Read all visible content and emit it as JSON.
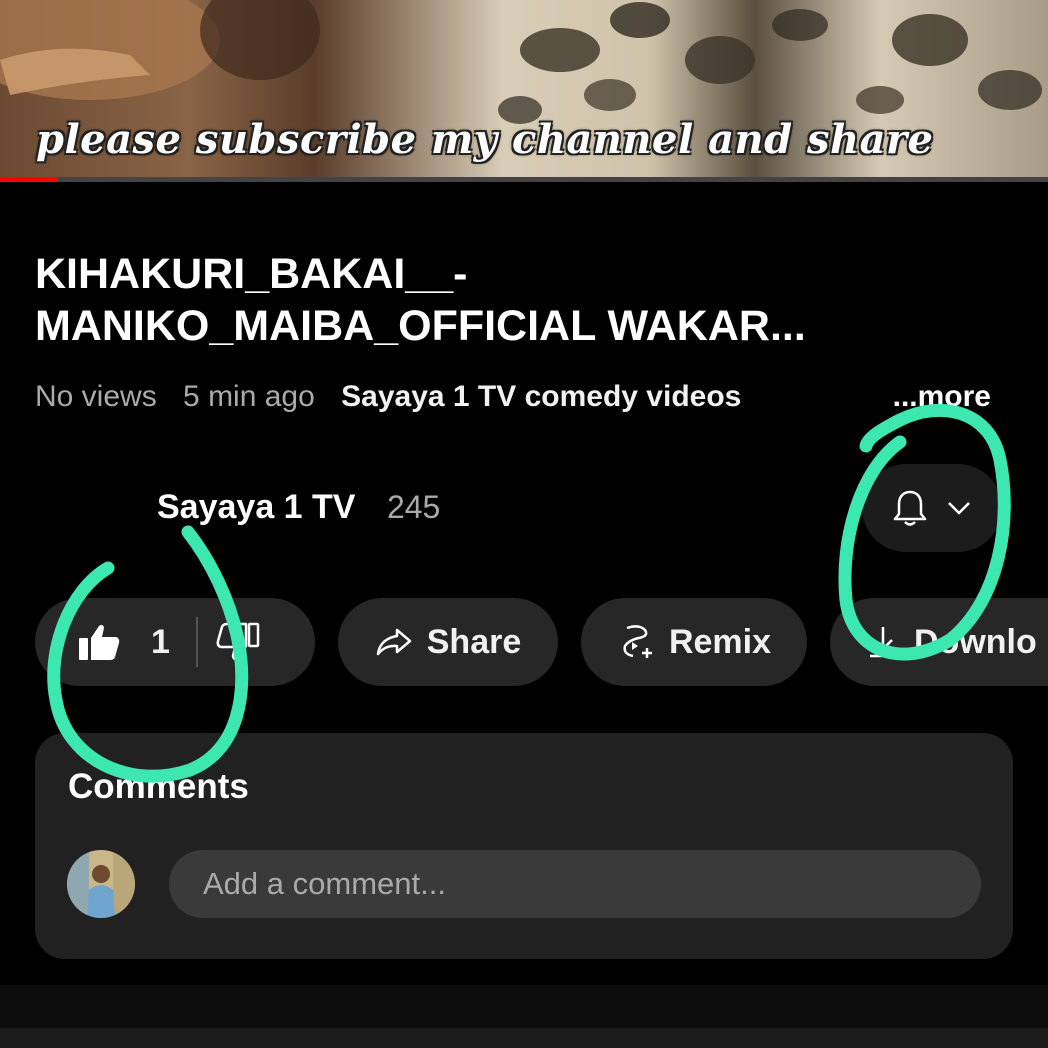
{
  "video": {
    "caption": "please subscribe my channel and share",
    "progress_fraction": 0.054
  },
  "title_lines": [
    "KIHAKURI_BAKAI__-",
    "MANIKO_MAIBA_OFFICIAL WAKAR..."
  ],
  "meta": {
    "views": "No views",
    "time": "5 min ago",
    "channel_link": "Sayaya 1 TV comedy videos",
    "more": "...more"
  },
  "channel": {
    "name": "Sayaya 1 TV",
    "subscribers": "245",
    "bell_icon": "bell-icon",
    "chevron_icon": "chevron-down-icon"
  },
  "actions": {
    "like_count": "1",
    "share_label": "Share",
    "remix_label": "Remix",
    "download_label": "Downlo"
  },
  "comments": {
    "title": "Comments",
    "placeholder": "Add a comment..."
  },
  "colors": {
    "progress": "#ff0000",
    "annotation": "#3de8b0",
    "pill_bg": "#272727",
    "comments_bg": "#212121"
  }
}
